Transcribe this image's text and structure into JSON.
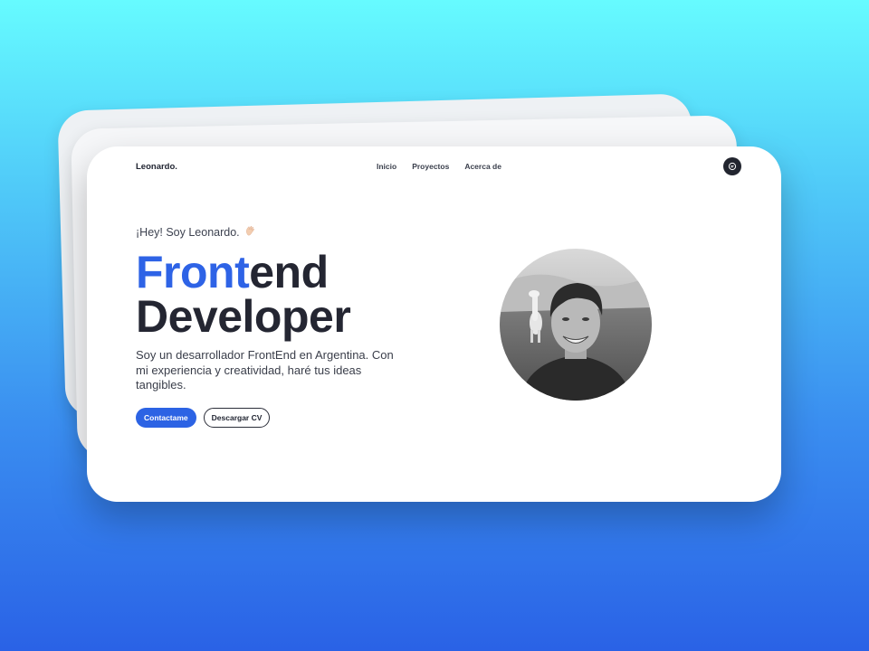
{
  "brand": {
    "logo": "Leonardo."
  },
  "nav": {
    "links": [
      "Inicio",
      "Proyectos",
      "Acerca de"
    ],
    "chat_icon": "chat-bubble-icon"
  },
  "hero": {
    "greeting": "¡Hey! Soy Leonardo.",
    "greeting_icon": "wave-hand-icon",
    "headline_accent": "Front",
    "headline_rest": "end",
    "headline_line2": "Developer",
    "description": "Soy un desarrollador FrontEnd en Argentina. Con mi experiencia y creatividad, haré tus ideas tangibles.",
    "primary_button": "Contactame",
    "secondary_button": "Descargar CV"
  },
  "colors": {
    "accent": "#2e63e6",
    "text_dark": "#242632",
    "background_top": "#66fbff",
    "background_bottom": "#2a62e6"
  }
}
